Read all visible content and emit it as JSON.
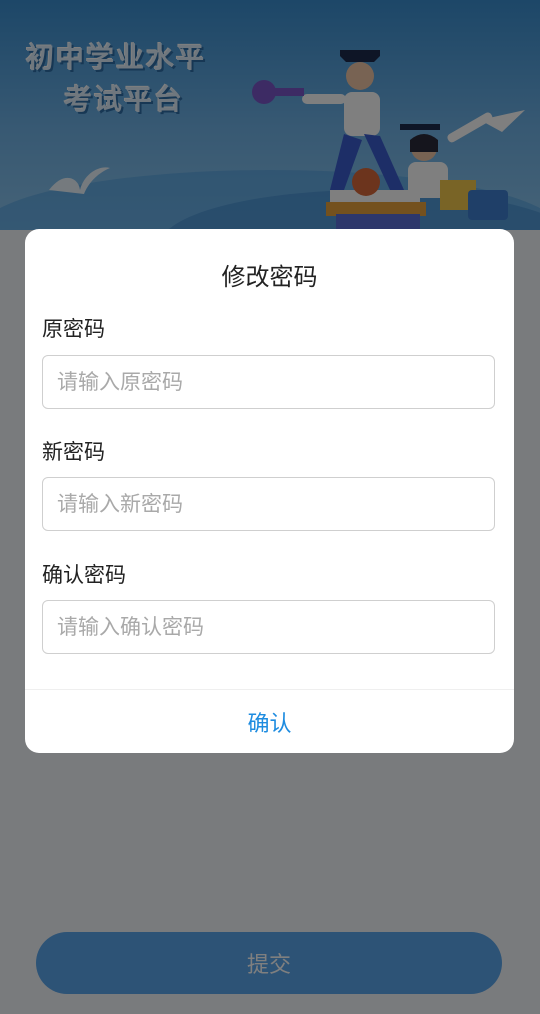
{
  "banner": {
    "title_line1": "初中学业水平",
    "title_line2": "考试平台"
  },
  "submit": {
    "label": "提交"
  },
  "dialog": {
    "title": "修改密码",
    "fields": [
      {
        "label": "原密码",
        "placeholder": "请输入原密码"
      },
      {
        "label": "新密码",
        "placeholder": "请输入新密码"
      },
      {
        "label": "确认密码",
        "placeholder": "请输入确认密码"
      }
    ],
    "confirm_label": "确认"
  },
  "colors": {
    "banner": "#3a8ed0",
    "accent": "#1e8ce0",
    "button": "#5aa6ec"
  }
}
